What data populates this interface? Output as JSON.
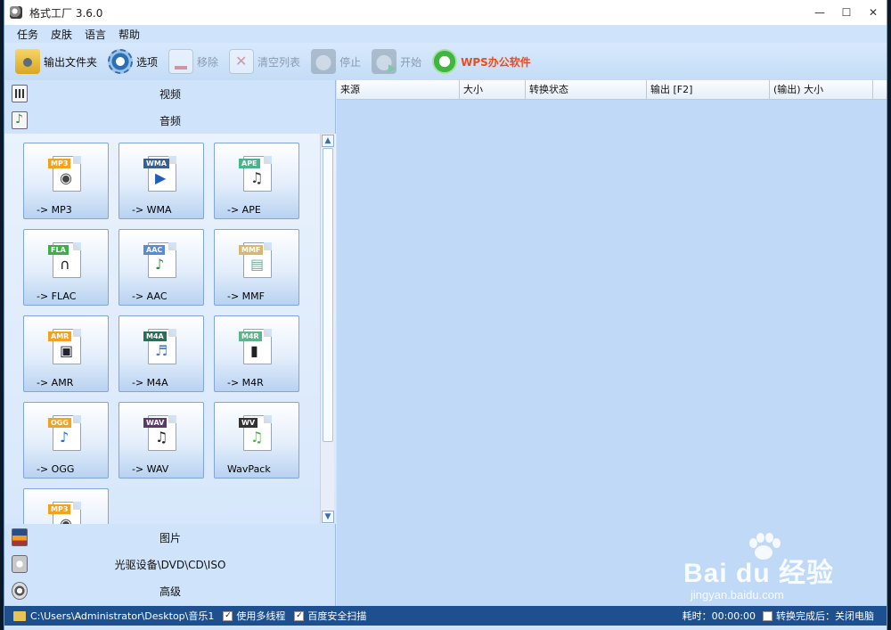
{
  "window": {
    "title": "格式工厂 3.6.0",
    "controls": [
      "—",
      "☐",
      "✕"
    ]
  },
  "menu": [
    "任务",
    "皮肤",
    "语言",
    "帮助"
  ],
  "toolbar": {
    "output_folder": "输出文件夹",
    "options": "选项",
    "remove": "移除",
    "clear_list": "清空列表",
    "stop": "停止",
    "start": "开始",
    "wps": "WPS办公软件"
  },
  "categories": {
    "video": "视频",
    "audio": "音频",
    "image": "图片",
    "disc": "光驱设备\\DVD\\CD\\ISO",
    "advanced": "高级"
  },
  "formats": [
    {
      "tag": "MP3",
      "label": "-> MP3",
      "tag_color": "#f2a21c",
      "glyph": "◉",
      "glyph_color": "#444"
    },
    {
      "tag": "WMA",
      "label": "-> WMA",
      "tag_color": "#3a5f8f",
      "glyph": "▶",
      "glyph_color": "#1f5fb5"
    },
    {
      "tag": "APE",
      "label": "-> APE",
      "tag_color": "#4bb38a",
      "glyph": "♫",
      "glyph_color": "#333"
    },
    {
      "tag": "FLA",
      "label": "-> FLAC",
      "tag_color": "#3fae4a",
      "glyph": "∩",
      "glyph_color": "#222"
    },
    {
      "tag": "AAC",
      "label": "-> AAC",
      "tag_color": "#5a89d6",
      "glyph": "♪",
      "glyph_color": "#2f8a3f"
    },
    {
      "tag": "MMF",
      "label": "-> MMF",
      "tag_color": "#d8b870",
      "glyph": "▤",
      "glyph_color": "#7a9"
    },
    {
      "tag": "AMR",
      "label": "-> AMR",
      "tag_color": "#f2a21c",
      "glyph": "▣",
      "glyph_color": "#223"
    },
    {
      "tag": "M4A",
      "label": "-> M4A",
      "tag_color": "#2f6b57",
      "glyph": "♬",
      "glyph_color": "#4a7fbf"
    },
    {
      "tag": "M4R",
      "label": "-> M4R",
      "tag_color": "#5fb38a",
      "glyph": "▮",
      "glyph_color": "#222"
    },
    {
      "tag": "OGG",
      "label": "-> OGG",
      "tag_color": "#f2a21c",
      "glyph": "♪",
      "glyph_color": "#1f6fd0"
    },
    {
      "tag": "WAV",
      "label": "-> WAV",
      "tag_color": "#5b3a6b",
      "glyph": "♫",
      "glyph_color": "#222"
    },
    {
      "tag": "WV",
      "label": "WavPack",
      "tag_color": "#333333",
      "glyph": "♫",
      "glyph_color": "#3fb63f"
    },
    {
      "tag": "MP3",
      "label": "",
      "tag_color": "#f2a21c",
      "glyph": "◉",
      "glyph_color": "#444"
    }
  ],
  "table": {
    "columns": [
      "来源",
      "大小",
      "转换状态",
      "输出 [F2]",
      "(输出) 大小"
    ]
  },
  "status": {
    "path": "C:\\Users\\Administrator\\Desktop\\音乐1",
    "multithread": "使用多线程",
    "baidu_scan": "百度安全扫描",
    "elapsed": "耗时：00:00:00",
    "after_convert": "转换完成后：关闭电脑"
  },
  "watermark": {
    "logo": "Bai du 经验",
    "url": "jingyan.baidu.com"
  }
}
